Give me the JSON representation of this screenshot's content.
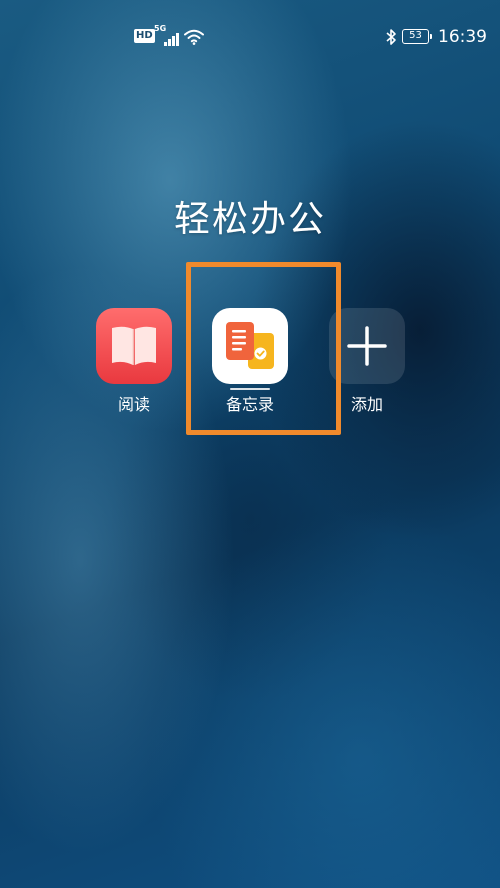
{
  "status_bar": {
    "hd_badge": "HD",
    "network_type": "5G",
    "signal_icon": "signal-bars-icon",
    "wifi_icon": "wifi-icon",
    "bluetooth_icon": "bluetooth-icon",
    "battery_level": "53",
    "time": "16:39"
  },
  "folder": {
    "title": "轻松办公",
    "apps": [
      {
        "label": "阅读",
        "icon": "book-icon",
        "color": "#ef4146"
      },
      {
        "label": "备忘录",
        "icon": "notes-icon",
        "color": "#ffffff",
        "selected": true
      },
      {
        "label": "添加",
        "icon": "plus-icon"
      }
    ]
  },
  "colors": {
    "highlight": "#f08a2c",
    "wallpaper": "#0d3f63"
  }
}
